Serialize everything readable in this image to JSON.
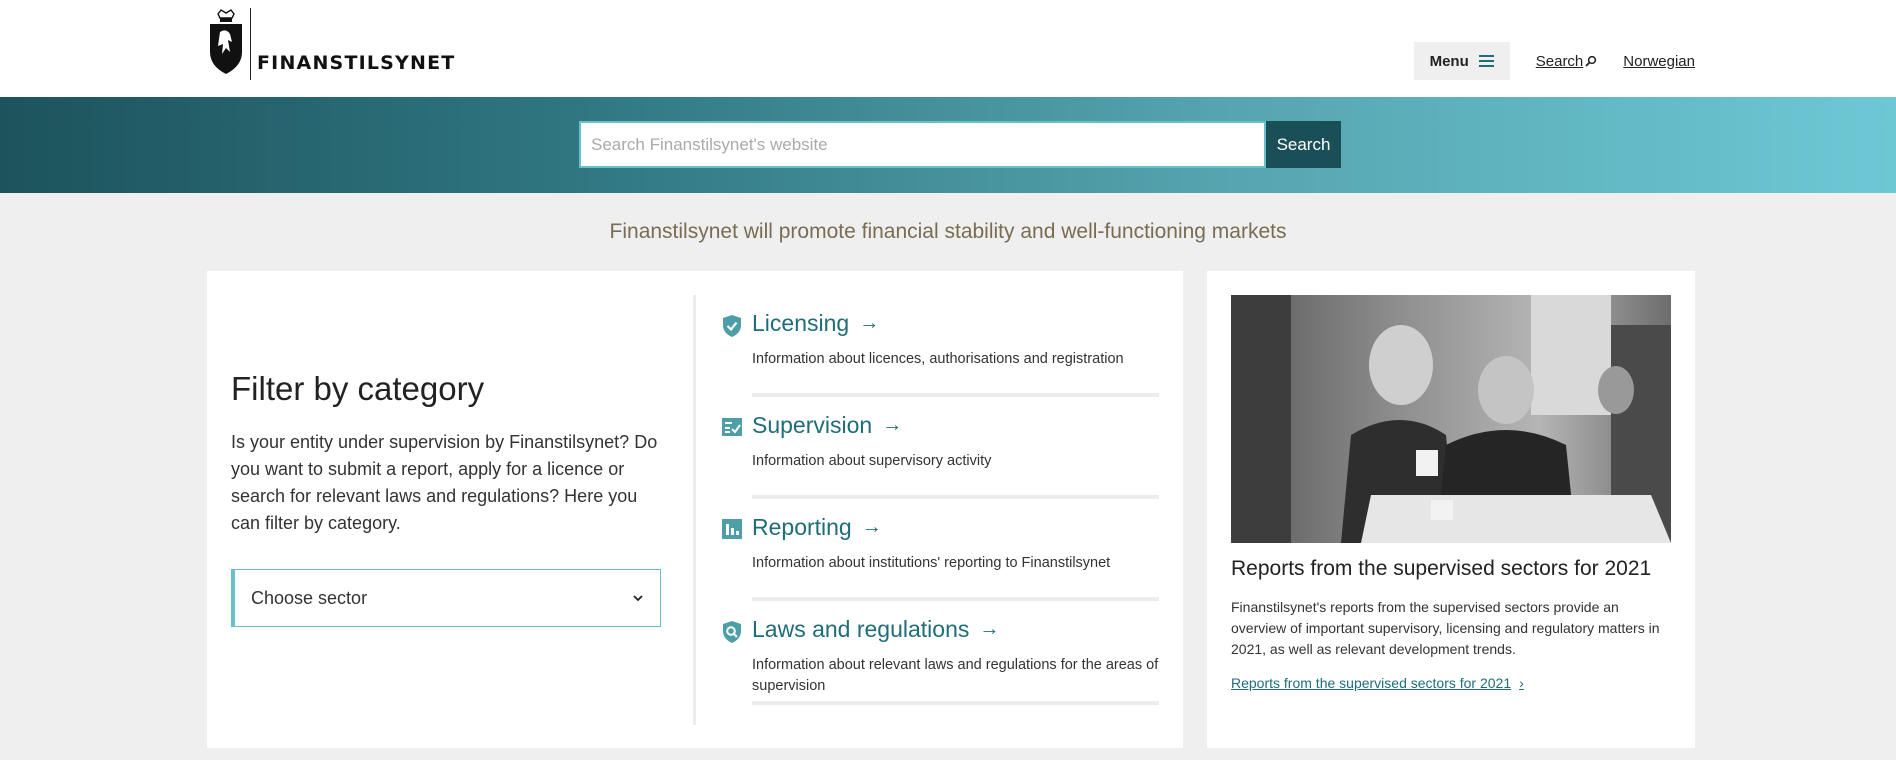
{
  "header": {
    "logo_text": "FINANSTILSYNET",
    "menu_label": "Menu",
    "search_link": "Search",
    "language_link": "Norwegian"
  },
  "search": {
    "placeholder": "Search Finanstilsynet's website",
    "button_label": "Search"
  },
  "tagline": "Finanstilsynet will promote financial stability and well-functioning markets",
  "filter": {
    "title": "Filter by category",
    "description": "Is your entity under supervision by Finanstilsynet? Do you want to submit a report, apply for a licence or search for relevant laws and regulations? Here you can filter by category.",
    "select_label": "Choose sector"
  },
  "categories": [
    {
      "title": "Licensing",
      "description": "Information about licences, authorisations and registration",
      "icon": "shield-check-icon"
    },
    {
      "title": "Supervision",
      "description": "Information about supervisory activity",
      "icon": "checklist-icon"
    },
    {
      "title": "Reporting",
      "description": "Information about institutions' reporting to Finanstilsynet",
      "icon": "bar-chart-icon"
    },
    {
      "title": "Laws and regulations",
      "description": "Information about relevant laws and regulations for the areas of supervision",
      "icon": "shield-search-icon"
    }
  ],
  "feature": {
    "title": "Reports from the supervised sectors for 2021",
    "description": "Finanstilsynet's reports from the supervised sectors provide an overview of important supervisory, licensing and regulatory matters in 2021, as well as relevant development trends.",
    "link_label": "Reports from the supervised sectors for 2021"
  },
  "colors": {
    "accent": "#1f6d78",
    "banner_dark": "#1d535c",
    "banner_light": "#6dc8d5",
    "search_button": "#1b4f57",
    "tagline": "#7a6c52"
  }
}
